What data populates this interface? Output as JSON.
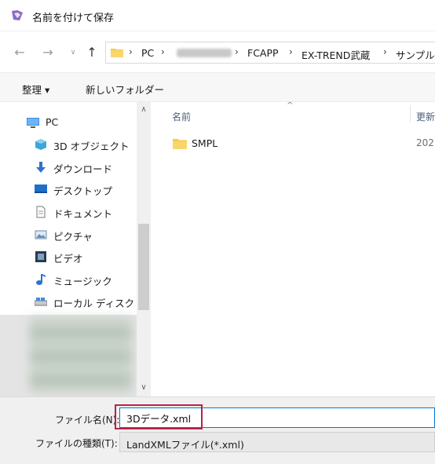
{
  "window": {
    "title": "名前を付けて保存"
  },
  "nav": {
    "back_icon": "arrow-left-icon",
    "forward_icon": "arrow-right-icon",
    "recent_icon": "chevron-down-icon",
    "up_icon": "arrow-up-icon",
    "breadcrumb": [
      "PC",
      "FCAPP",
      "EX-TREND武蔵",
      "サンプル"
    ]
  },
  "toolbar": {
    "organize_label": "整理 ▾",
    "new_folder_label": "新しいフォルダー"
  },
  "sidebar": {
    "items": [
      {
        "label": "PC",
        "icon": "pc-icon"
      },
      {
        "label": "3D オブジェクト",
        "icon": "3d-objects-icon"
      },
      {
        "label": "ダウンロード",
        "icon": "download-icon"
      },
      {
        "label": "デスクトップ",
        "icon": "desktop-icon"
      },
      {
        "label": "ドキュメント",
        "icon": "document-icon"
      },
      {
        "label": "ピクチャ",
        "icon": "picture-icon"
      },
      {
        "label": "ビデオ",
        "icon": "video-icon"
      },
      {
        "label": "ミュージック",
        "icon": "music-icon"
      },
      {
        "label": "ローカル ディスク (C",
        "icon": "local-disk-icon"
      }
    ]
  },
  "files": {
    "columns": {
      "name": "名前",
      "date": "更新日時"
    },
    "rows": [
      {
        "name": "SMPL",
        "date": "202",
        "icon": "folder-icon"
      }
    ]
  },
  "bottom": {
    "filename_label": "ファイル名(N):",
    "filename_value": "3Dデータ.xml",
    "filetype_label": "ファイルの種類(T):",
    "filetype_value": "LandXMLファイル(*.xml)"
  },
  "colors": {
    "accent": "#0078d7",
    "highlight_box": "#b5234a",
    "folder": "#f6c94a"
  }
}
